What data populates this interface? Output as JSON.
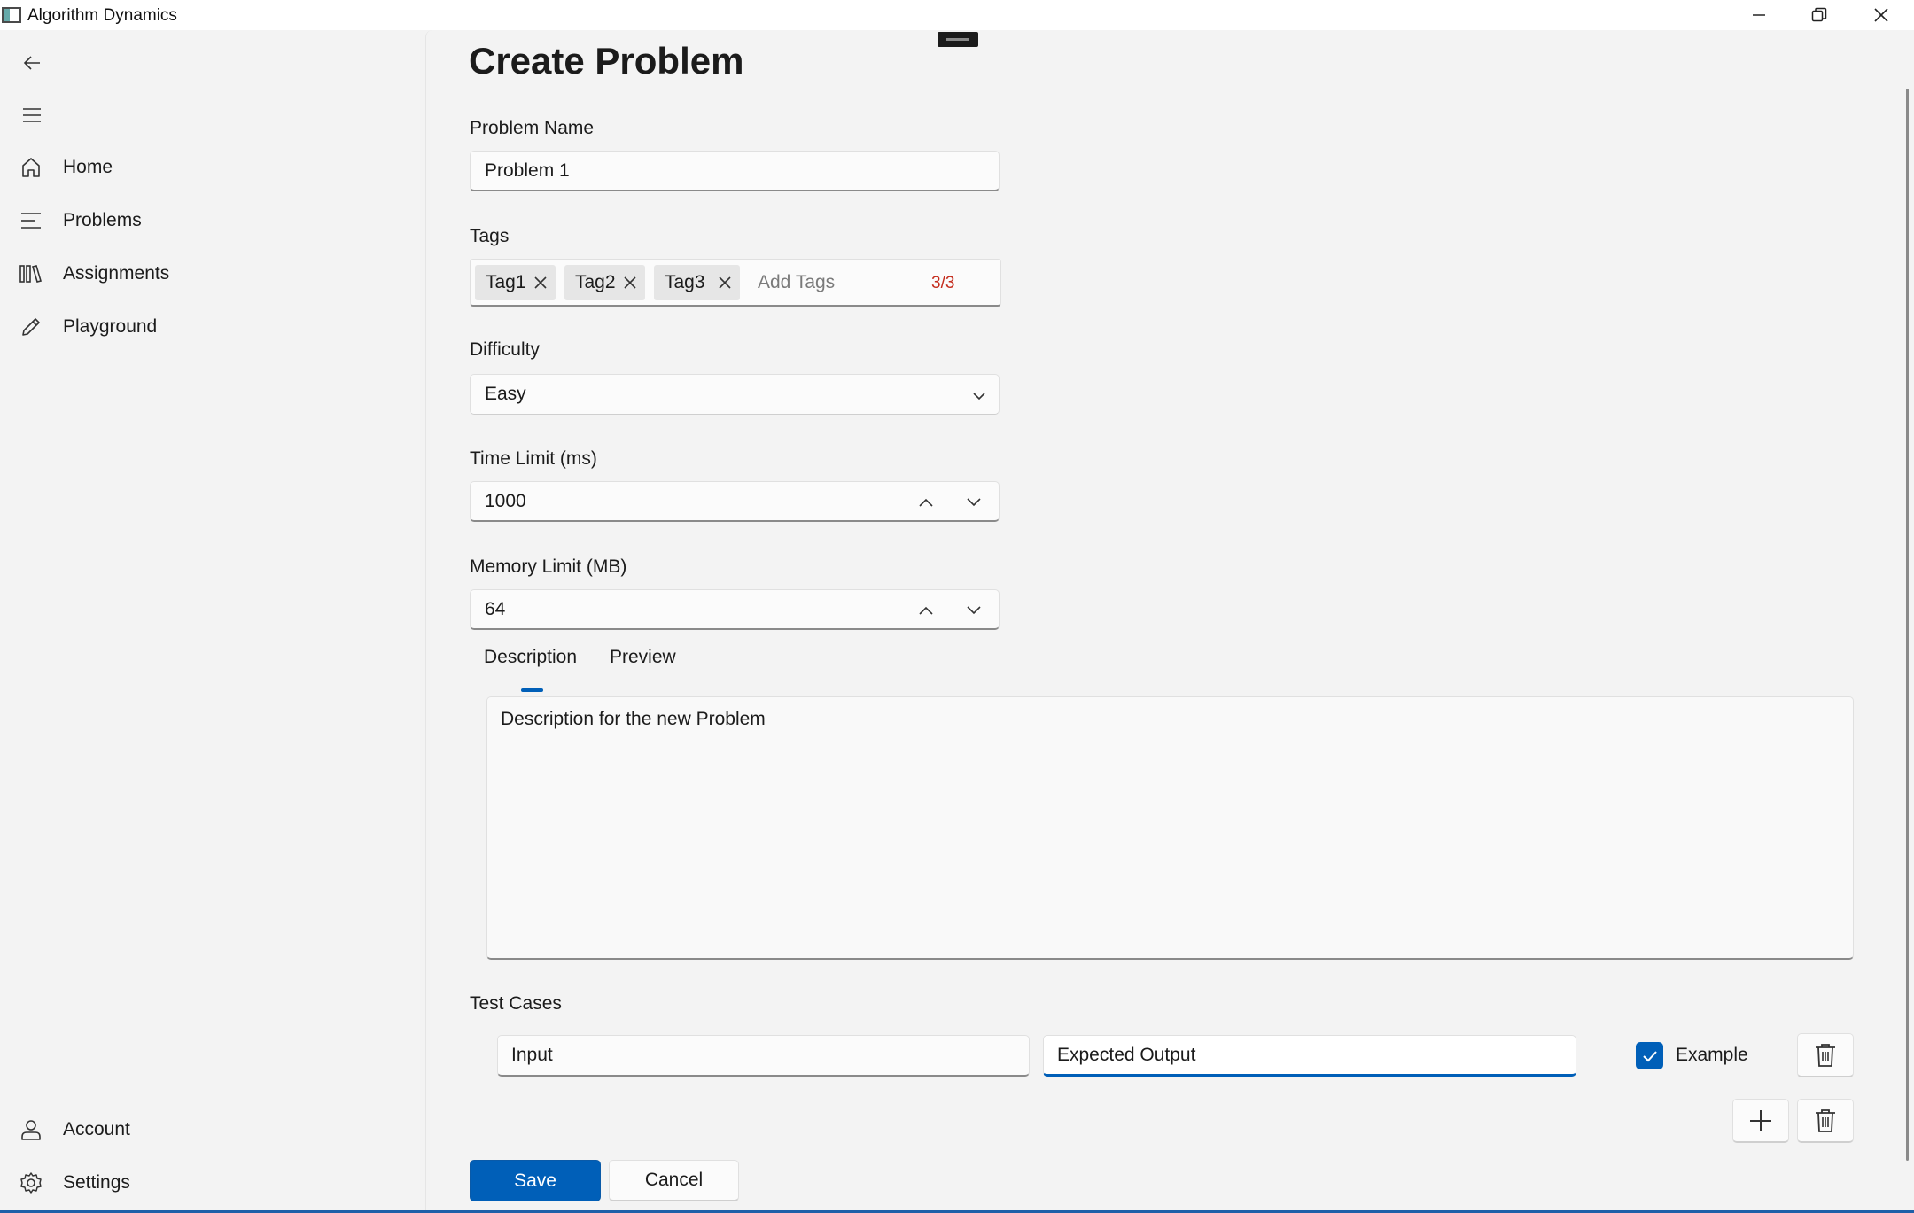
{
  "window": {
    "title": "Algorithm Dynamics"
  },
  "sidebar": {
    "items": [
      {
        "label": "Home",
        "icon": "home-icon"
      },
      {
        "label": "Problems",
        "icon": "list-icon"
      },
      {
        "label": "Assignments",
        "icon": "library-icon"
      },
      {
        "label": "Playground",
        "icon": "pencil-icon"
      }
    ],
    "footer_items": [
      {
        "label": "Account",
        "icon": "person-icon"
      },
      {
        "label": "Settings",
        "icon": "gear-icon"
      }
    ]
  },
  "page": {
    "title": "Create Problem"
  },
  "form": {
    "problem_name": {
      "label": "Problem Name",
      "value": "Problem 1"
    },
    "tags": {
      "label": "Tags",
      "chips": [
        "Tag1",
        "Tag2",
        "Tag3"
      ],
      "placeholder": "Add Tags",
      "count": "3/3"
    },
    "difficulty": {
      "label": "Difficulty",
      "value": "Easy"
    },
    "time_limit": {
      "label": "Time Limit (ms)",
      "value": "1000"
    },
    "memory_limit": {
      "label": "Memory Limit (MB)",
      "value": "64"
    },
    "description_tabs": [
      "Description",
      "Preview"
    ],
    "description": "Description for the new Problem",
    "test_cases": {
      "label": "Test Cases",
      "rows": [
        {
          "input_placeholder": "Input",
          "output_placeholder": "Expected Output",
          "example_label": "Example",
          "example_checked": true
        }
      ]
    }
  },
  "actions": {
    "save": "Save",
    "cancel": "Cancel"
  },
  "colors": {
    "accent": "#005fb8",
    "error": "#c42b1c"
  }
}
